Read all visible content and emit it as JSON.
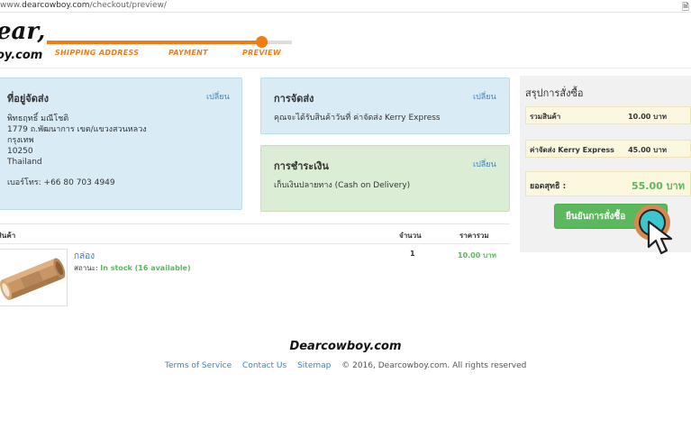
{
  "browser": {
    "url_prefix": "www.",
    "url_domain": "dearcowboy.com",
    "url_path": "/checkout/preview/"
  },
  "header": {
    "logo_line1": "ear,",
    "logo_line2": "oy.com",
    "steps": [
      "SHIPPING ADDRESS",
      "PAYMENT",
      "PREVIEW"
    ],
    "progress_percent": 88,
    "accent_color": "#f07d12"
  },
  "address": {
    "title": "ที่อยู่จัดส่ง",
    "change_label": "เปลี่ยน",
    "lines": [
      "พิทธฤทธิ์ มณีโชติ",
      "1779 ถ.พัฒนาการ เขต/แขวงสวนหลวง",
      "กรุงเทพ",
      "10250",
      "Thailand"
    ],
    "phone": "เบอร์โทร: +66 80 703 4949"
  },
  "shipping": {
    "title": "การจัดส่ง",
    "change_label": "เปลี่ยน",
    "text": "คุณจะได้รับสินค้าวันที่ ค่าจัดส่ง Kerry Express"
  },
  "payment": {
    "title": "การชำระเงิน",
    "change_label": "เปลี่ยน",
    "text": "เก็บเงินปลายทาง (Cash on Delivery)"
  },
  "items_table": {
    "headers": [
      "สินค้า",
      "จำนวน",
      "ราคารวม"
    ],
    "rows": [
      {
        "name": "กล่อง",
        "status_label": "สถานะ:",
        "stock": "In stock (16 available)",
        "qty": "1",
        "price": "10.00 บาท"
      }
    ]
  },
  "summary": {
    "title": "สรุปการสั่งซื้อ",
    "subtotal_label": "รวมสินค้า",
    "subtotal_value": "10.00 บาท",
    "shipping_label": "ค่าจัดส่ง Kerry Express",
    "shipping_value": "45.00 บาท",
    "total_label": "ยอดสุทธิ :",
    "total_value": "55.00 บาท",
    "confirm_label": "ยืนยันการสั่งซื้อ",
    "success_color": "#5cb85c"
  },
  "footer": {
    "brand": "Dearcowboy.com",
    "links": [
      "Terms of Service",
      "Contact Us",
      "Sitemap"
    ],
    "copyright": "© 2016, Dearcowboy.com. All rights reserved"
  },
  "icons": {
    "page_icon": "document-icon",
    "cursor": "pointer-cursor-icon"
  }
}
